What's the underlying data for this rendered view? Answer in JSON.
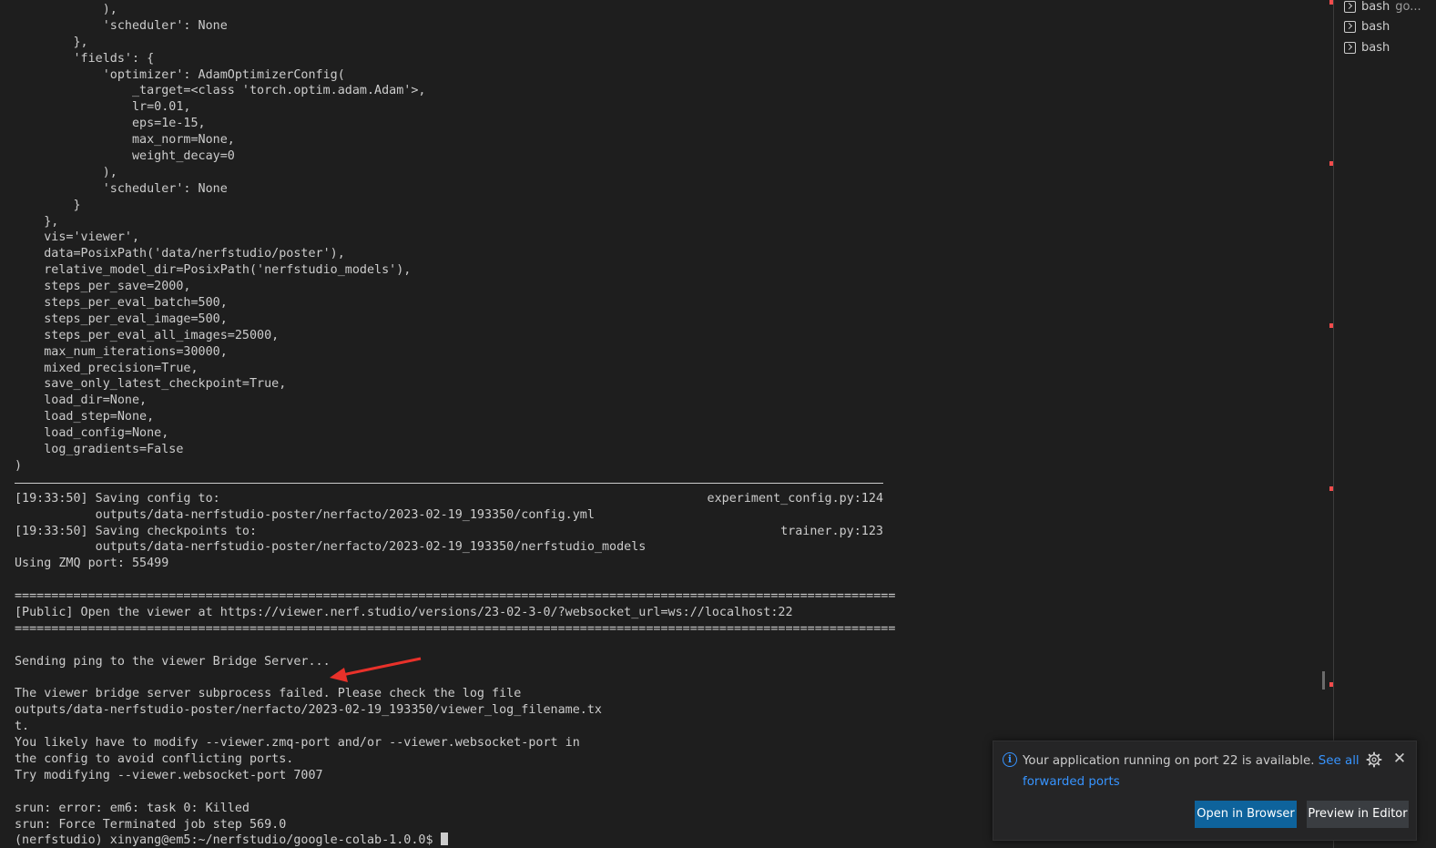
{
  "terminal": {
    "lines": [
      "            ),",
      "            'scheduler': None",
      "        },",
      "        'fields': {",
      "            'optimizer': AdamOptimizerConfig(",
      "                _target=<class 'torch.optim.adam.Adam'>,",
      "                lr=0.01,",
      "                eps=1e-15,",
      "                max_norm=None,",
      "                weight_decay=0",
      "            ),",
      "            'scheduler': None",
      "        }",
      "    },",
      "    vis='viewer',",
      "    data=PosixPath('data/nerfstudio/poster'),",
      "    relative_model_dir=PosixPath('nerfstudio_models'),",
      "    steps_per_save=2000,",
      "    steps_per_eval_batch=500,",
      "    steps_per_eval_image=500,",
      "    steps_per_eval_all_images=25000,",
      "    max_num_iterations=30000,",
      "    mixed_precision=True,",
      "    save_only_latest_checkpoint=True,",
      "    load_dir=None,",
      "    load_step=None,",
      "    load_config=None,",
      "    log_gradients=False",
      ")",
      "",
      "[19:33:50] Saving config to:",
      "           outputs/data-nerfstudio-poster/nerfacto/2023-02-19_193350/config.yml",
      "[19:33:50] Saving checkpoints to:",
      "           outputs/data-nerfstudio-poster/nerfacto/2023-02-19_193350/nerfstudio_models",
      "Using ZMQ port: 55499",
      "",
      "========================================================================================================================",
      "[Public] Open the viewer at https://viewer.nerf.studio/versions/23-02-3-0/?websocket_url=ws://localhost:22",
      "========================================================================================================================",
      "",
      "Sending ping to the viewer Bridge Server...",
      "",
      "The viewer bridge server subprocess failed. Please check the log file",
      "outputs/data-nerfstudio-poster/nerfacto/2023-02-19_193350/viewer_log_filename.tx",
      "t.",
      "You likely have to modify --viewer.zmq-port and/or --viewer.websocket-port in",
      "the config to avoid conflicting ports.",
      "Try modifying --viewer.websocket-port 7007",
      "",
      "srun: error: em6: task 0: Killed",
      "srun: Force Terminated job step 569.0",
      "(nerfstudio) xinyang@em5:~/nerfstudio/google-colab-1.0.0$ "
    ],
    "right_notes": {
      "config_source": "experiment_config.py:124",
      "checkpoint_source": "trainer.py:123"
    }
  },
  "tabs": [
    {
      "icon": "terminal-icon",
      "label": "bash",
      "sub": "go..."
    },
    {
      "icon": "terminal-icon",
      "label": "bash",
      "sub": ""
    },
    {
      "icon": "terminal-icon",
      "label": "bash",
      "sub": ""
    }
  ],
  "notification": {
    "message": "Your application running on port 22 is available. ",
    "link": "See all forwarded ports",
    "buttons": {
      "open_browser": "Open in Browser",
      "preview_editor": "Preview in Editor"
    }
  },
  "colors": {
    "background": "#1e1e1e",
    "text": "#cccccc",
    "accent": "#3794ff",
    "primary_button": "#0e639c",
    "arrow": "#e8312a"
  }
}
